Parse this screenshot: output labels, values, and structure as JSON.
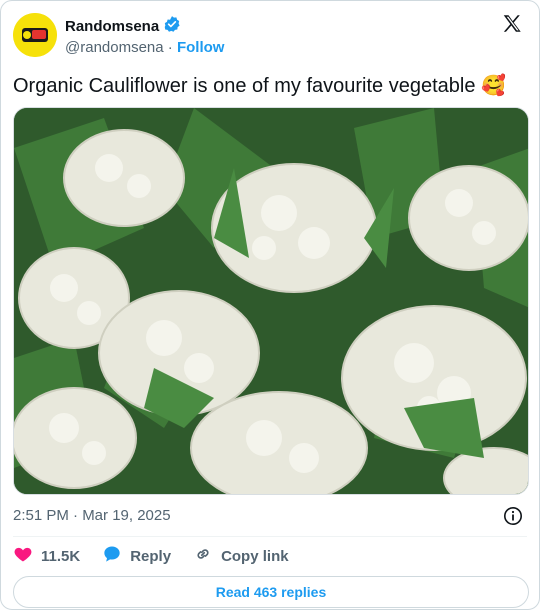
{
  "user": {
    "name": "Randomsena",
    "handle": "@randomsena",
    "separator": "·",
    "follow_label": "Follow",
    "verified_icon": "verified-badge-icon",
    "avatar_color": "#f6e10a"
  },
  "tweet": {
    "text": "Organic Cauliflower is one of my favourite vegetable",
    "emoji": "🥰",
    "photo_subject": "cauliflower heads with green leaves",
    "timestamp": "2:51 PM · Mar 19, 2025"
  },
  "actions": {
    "like_count": "11.5K",
    "reply_label": "Reply",
    "copy_link_label": "Copy link",
    "read_replies_label": "Read 463 replies"
  },
  "colors": {
    "accent": "#1d9bf0",
    "like": "#f91880",
    "muted": "#536471",
    "text": "#0f1419"
  }
}
